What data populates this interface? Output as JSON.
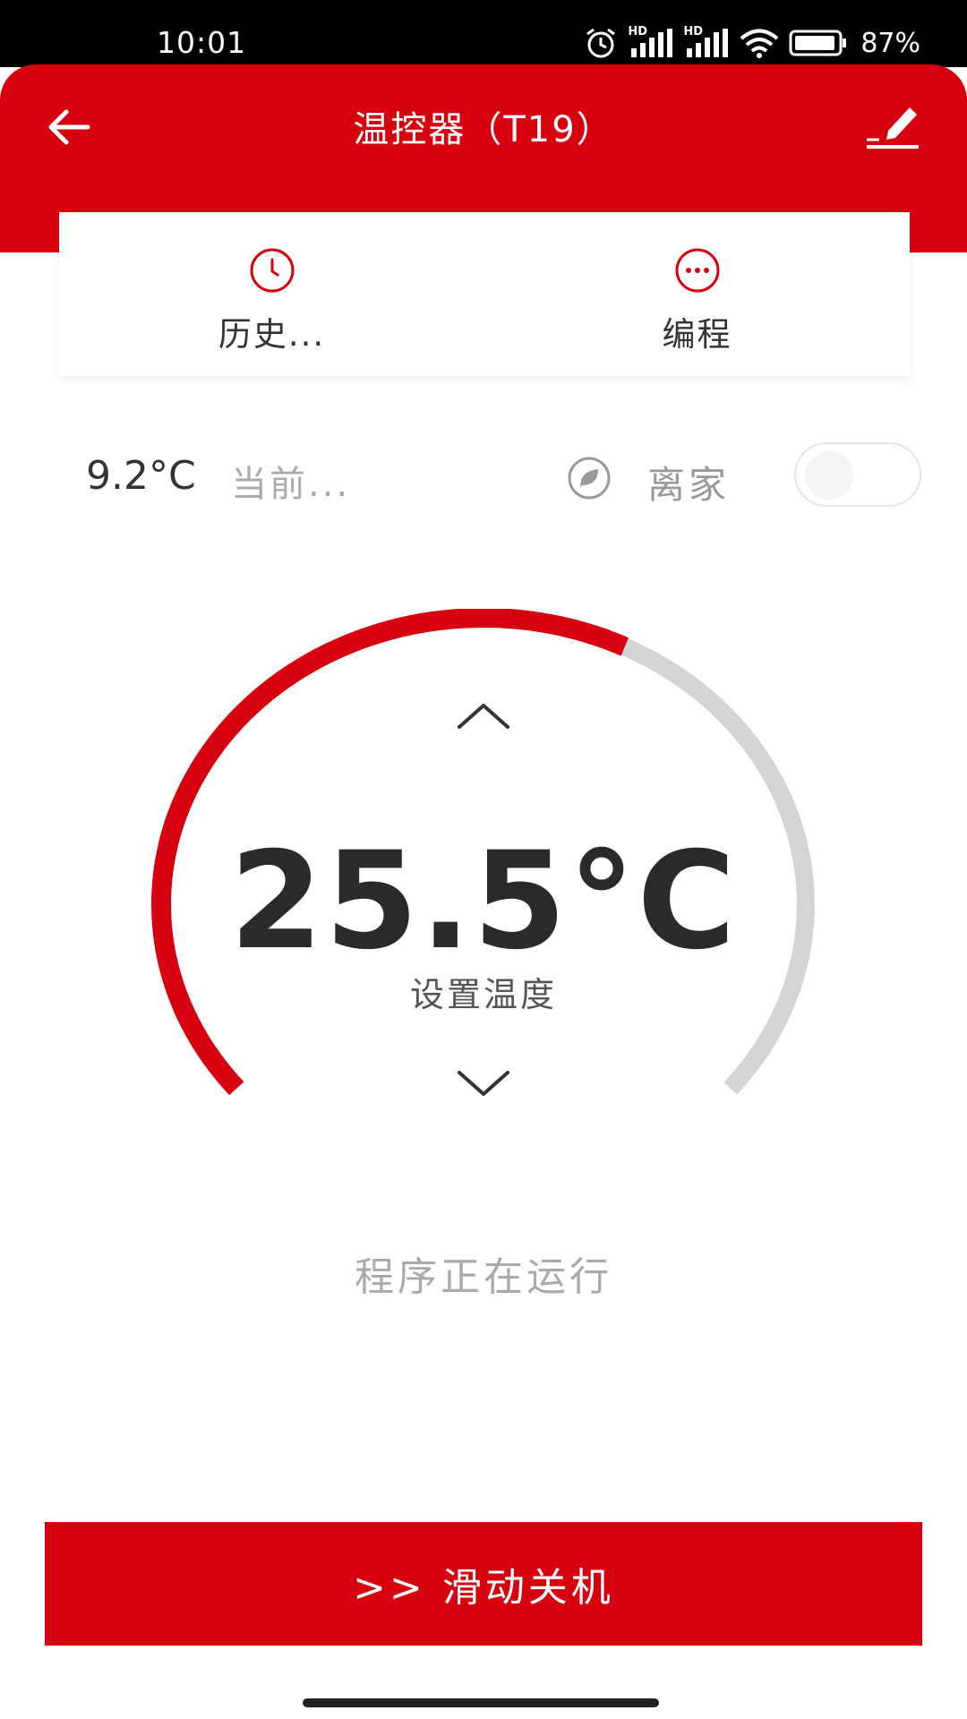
{
  "status_bar": {
    "time": "10:01",
    "signal1_badge": "HD",
    "signal2_badge": "HD",
    "battery": "87%"
  },
  "header": {
    "title": "温控器（T19）",
    "back_icon": "arrow-left-icon",
    "edit_icon": "pencil-icon",
    "background_color": "#d7000f"
  },
  "tabs": [
    {
      "label": "历史...",
      "icon": "clock-icon"
    },
    {
      "label": "编程",
      "icon": "more-dots-icon"
    }
  ],
  "info": {
    "current_temp": "9.2°C",
    "current_label": "当前...",
    "away_label": "离家",
    "away_enabled": false
  },
  "dial": {
    "set_temp": "25.5°C",
    "set_label": "设置温度",
    "fill_fraction": 0.6,
    "active_color": "#d7000f",
    "inactive_color": "#d4d4d4"
  },
  "program_status": "程序正在运行",
  "slide_button_label": ">> 滑动关机"
}
